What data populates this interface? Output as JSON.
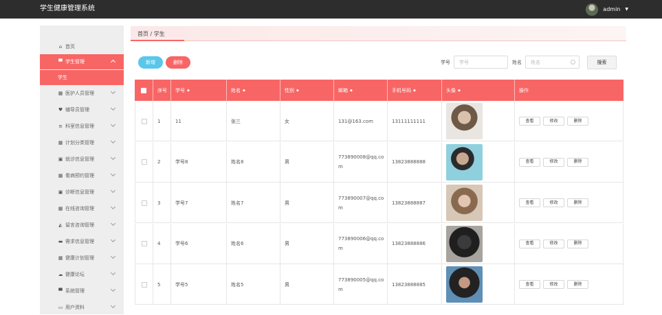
{
  "app": {
    "title": "学生健康管理系统",
    "user": "admin"
  },
  "sidebar": {
    "home": "首页",
    "items": [
      {
        "label": "学生管理",
        "icon": "chat-icon",
        "glyph": "▀",
        "active": true
      },
      {
        "label": "医护人员管理",
        "icon": "grid-icon",
        "glyph": "▦"
      },
      {
        "label": "辅导员管理",
        "icon": "heart-icon",
        "glyph": "♥"
      },
      {
        "label": "科室信息管理",
        "icon": "list-icon",
        "glyph": "≡"
      },
      {
        "label": "计划分类管理",
        "icon": "grid-icon",
        "glyph": "▦"
      },
      {
        "label": "就诊信息管理",
        "icon": "clipboard-icon",
        "glyph": "▣"
      },
      {
        "label": "看病预约管理",
        "icon": "grid-icon",
        "glyph": "▦"
      },
      {
        "label": "诊断信息管理",
        "icon": "clipboard-icon",
        "glyph": "▣"
      },
      {
        "label": "在线咨询管理",
        "icon": "grid-icon",
        "glyph": "▦"
      },
      {
        "label": "留言咨询管理",
        "icon": "thumb-icon",
        "glyph": "◭"
      },
      {
        "label": "需求信息管理",
        "icon": "card-icon",
        "glyph": "▬"
      },
      {
        "label": "健康计划管理",
        "icon": "grid-icon",
        "glyph": "▦"
      },
      {
        "label": "健康论坛",
        "icon": "cloud-icon",
        "glyph": "☁"
      },
      {
        "label": "系统管理",
        "icon": "chat-icon",
        "glyph": "▀"
      },
      {
        "label": "用户资料",
        "icon": "folder-icon",
        "glyph": "▭"
      }
    ],
    "sub_active": "学生"
  },
  "breadcrumb": "首页 / 学生",
  "toolbar": {
    "add": "新增",
    "delete": "删除",
    "id_label": "学号",
    "id_placeholder": "学号",
    "name_label": "姓名",
    "name_placeholder": "姓名",
    "search": "搜索"
  },
  "table": {
    "headers": [
      "序号",
      "学号",
      "姓名",
      "性别",
      "邮箱",
      "手机号码",
      "头像",
      "操作"
    ],
    "ops": {
      "view": "查看",
      "edit": "修改",
      "remove": "删除"
    },
    "rows": [
      {
        "no": "1",
        "sid": "11",
        "name": "张三",
        "gender": "女",
        "email": "131@163.com",
        "phone": "13111111111"
      },
      {
        "no": "2",
        "sid": "学号8",
        "name": "姓名8",
        "gender": "男",
        "email": "773890008@qq.com",
        "phone": "13823888888"
      },
      {
        "no": "3",
        "sid": "学号7",
        "name": "姓名7",
        "gender": "男",
        "email": "773890007@qq.com",
        "phone": "13823888887"
      },
      {
        "no": "4",
        "sid": "学号6",
        "name": "姓名6",
        "gender": "男",
        "email": "773890006@qq.com",
        "phone": "13823888886"
      },
      {
        "no": "5",
        "sid": "学号5",
        "name": "姓名5",
        "gender": "男",
        "email": "773890005@qq.com",
        "phone": "13823888885"
      }
    ]
  },
  "colors": {
    "accent": "#f76665",
    "topbar": "#2d2d2d",
    "add_button": "#5ac7ea"
  }
}
